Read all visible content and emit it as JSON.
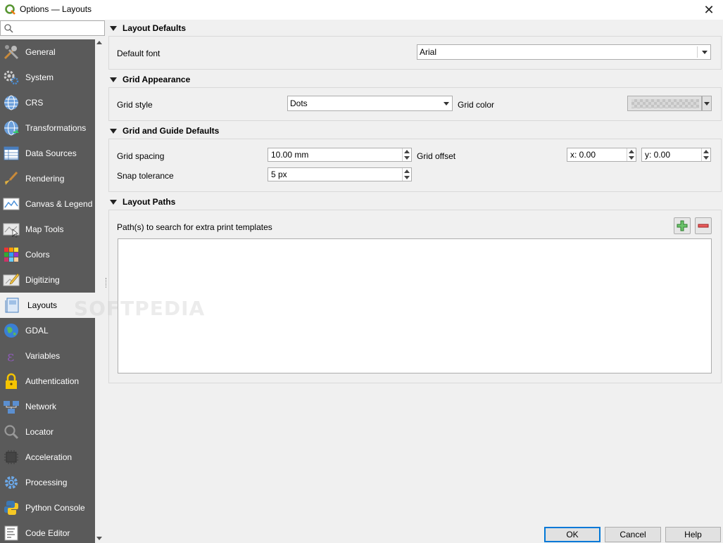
{
  "window": {
    "title": "Options — Layouts",
    "close_glyph": "✕"
  },
  "search": {
    "placeholder": ""
  },
  "sidebar": {
    "items": [
      {
        "label": "General",
        "icon": "tools-icon"
      },
      {
        "label": "System",
        "icon": "gears-icon"
      },
      {
        "label": "CRS",
        "icon": "globe-icon"
      },
      {
        "label": "Transformations",
        "icon": "globe-transform-icon"
      },
      {
        "label": "Data Sources",
        "icon": "table-icon"
      },
      {
        "label": "Rendering",
        "icon": "brush-icon"
      },
      {
        "label": "Canvas & Legend",
        "icon": "map-canvas-icon"
      },
      {
        "label": "Map Tools",
        "icon": "map-tools-icon"
      },
      {
        "label": "Colors",
        "icon": "color-grid-icon"
      },
      {
        "label": "Digitizing",
        "icon": "digitize-icon"
      },
      {
        "label": "Layouts",
        "icon": "layout-icon",
        "active": true
      },
      {
        "label": "GDAL",
        "icon": "gdal-globe-icon"
      },
      {
        "label": "Variables",
        "icon": "epsilon-icon"
      },
      {
        "label": "Authentication",
        "icon": "lock-icon"
      },
      {
        "label": "Network",
        "icon": "network-icon"
      },
      {
        "label": "Locator",
        "icon": "magnifier-icon"
      },
      {
        "label": "Acceleration",
        "icon": "chip-icon"
      },
      {
        "label": "Processing",
        "icon": "cog-icon"
      },
      {
        "label": "Python Console",
        "icon": "python-icon"
      },
      {
        "label": "Code Editor",
        "icon": "code-editor-icon"
      }
    ]
  },
  "layout_defaults": {
    "header": "Layout Defaults",
    "default_font_label": "Default font",
    "default_font_value": "Arial"
  },
  "grid_appearance": {
    "header": "Grid Appearance",
    "grid_style_label": "Grid style",
    "grid_style_value": "Dots",
    "grid_color_label": "Grid color"
  },
  "grid_guide_defaults": {
    "header": "Grid and Guide Defaults",
    "grid_spacing_label": "Grid spacing",
    "grid_spacing_value": "10.00 mm",
    "grid_offset_label": "Grid offset",
    "grid_offset_x": "x: 0.00",
    "grid_offset_y": "y: 0.00",
    "snap_tolerance_label": "Snap tolerance",
    "snap_tolerance_value": "5 px"
  },
  "layout_paths": {
    "header": "Layout Paths",
    "paths_label": "Path(s) to search for extra print templates",
    "paths": []
  },
  "footer": {
    "ok": "OK",
    "cancel": "Cancel",
    "help": "Help"
  },
  "watermark": "SOFTPEDIA",
  "colors": {
    "sidebar_bg": "#5a5a5a",
    "accent": "#0078d7",
    "add_green": "#2e9e2e",
    "remove_red": "#d23030"
  }
}
